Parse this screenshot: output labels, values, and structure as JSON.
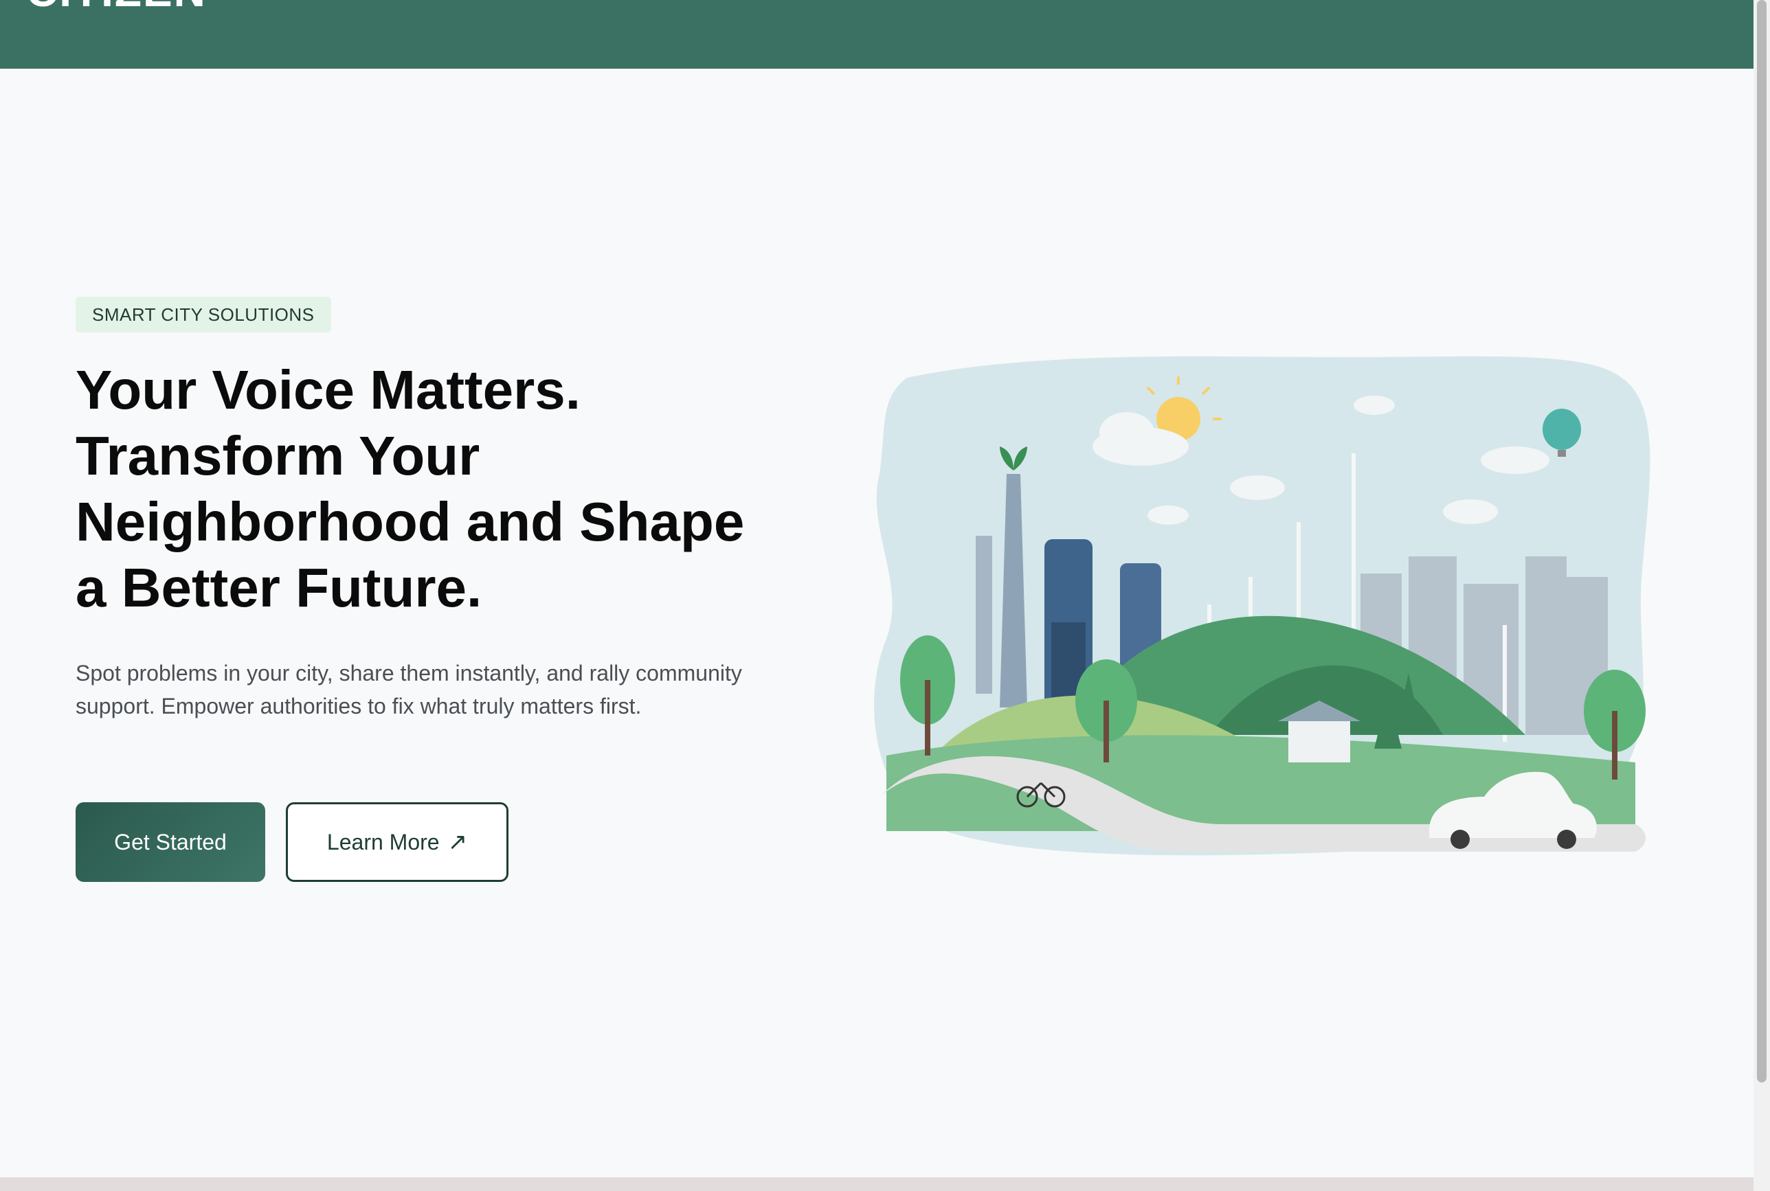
{
  "header": {
    "brand": "CITIZEN"
  },
  "hero": {
    "badge": "SMART CITY SOLUTIONS",
    "headline": "Your Voice Matters. Transform Your Neighborhood and Shape a Better Future.",
    "subtext": "Spot problems in your city, share them instantly, and rally community support. Empower authorities to fix what truly matters first.",
    "primary_button": "Get Started",
    "secondary_button": "Learn More",
    "secondary_icon": "arrow-up-right-icon"
  },
  "colors": {
    "header_bg": "#3a7163",
    "badge_bg": "#e4f3e7",
    "primary": "#2b5a4d",
    "background": "#f8f9fa"
  },
  "illustration": {
    "subject": "green-city-illustration"
  }
}
